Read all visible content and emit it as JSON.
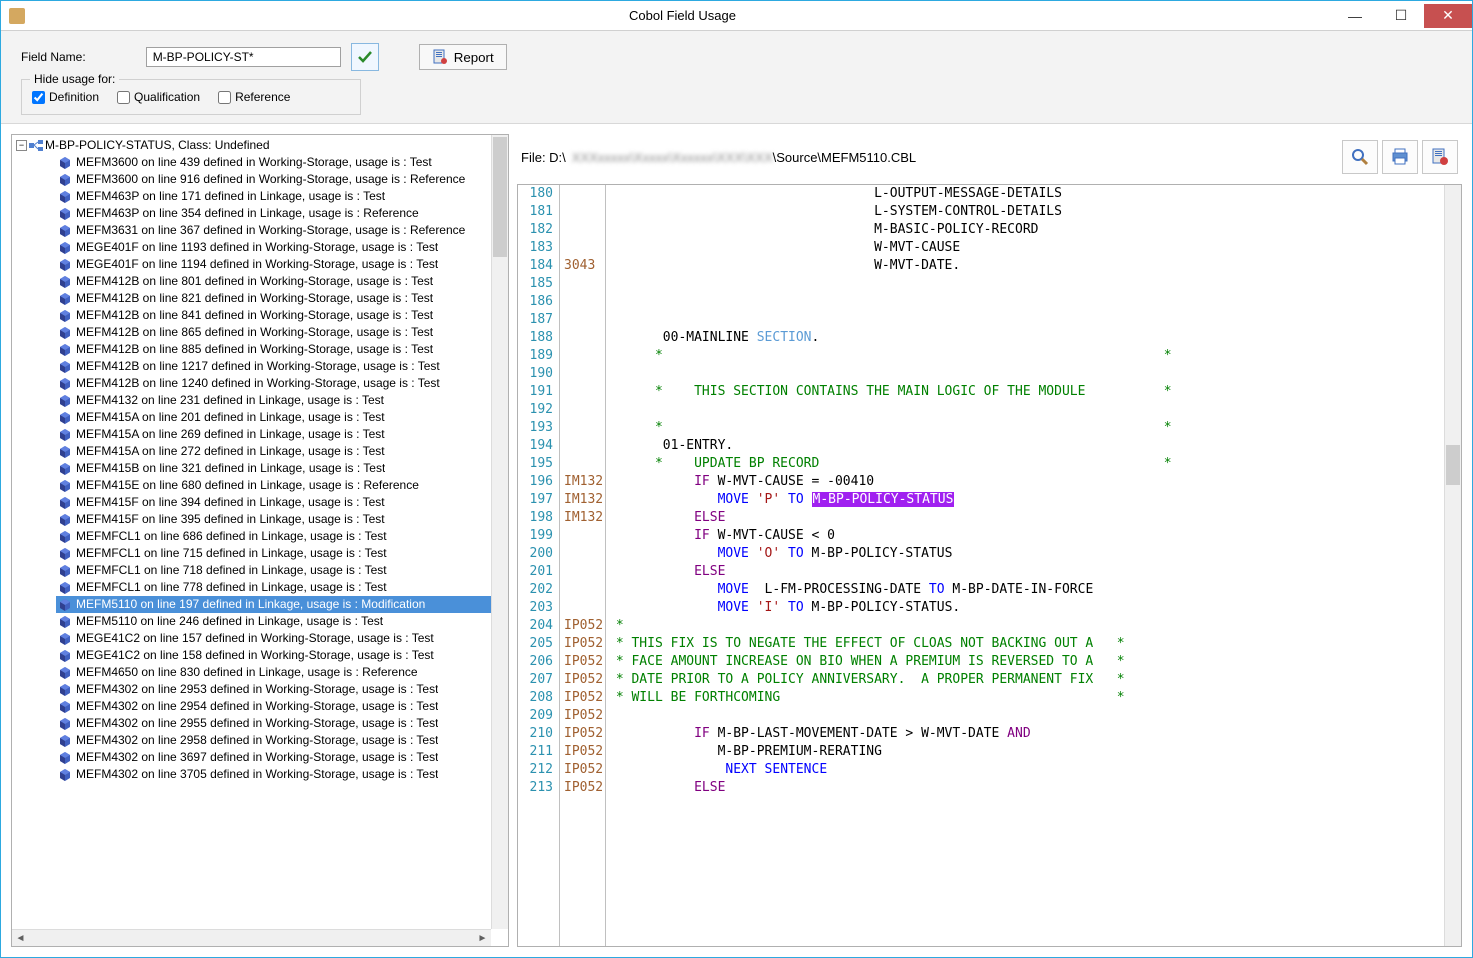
{
  "window": {
    "title": "Cobol Field Usage"
  },
  "toolbar": {
    "fieldNameLabel": "Field Name:",
    "fieldNameValue": "M-BP-POLICY-ST*",
    "reportLabel": "Report",
    "hideLegend": "Hide usage for:",
    "checks": {
      "definition": "Definition",
      "qualification": "Qualification",
      "reference": "Reference"
    }
  },
  "tree": {
    "rootLabel": "M-BP-POLICY-STATUS, Class: Undefined",
    "items": [
      {
        "l": "MEFM3600 on line 439 defined in Working-Storage, usage is : Test",
        "sel": false
      },
      {
        "l": "MEFM3600 on line 916 defined in Working-Storage, usage is : Reference",
        "sel": false
      },
      {
        "l": "MEFM463P on line 171 defined in Linkage, usage is : Test",
        "sel": false
      },
      {
        "l": "MEFM463P on line 354 defined in Linkage, usage is : Reference",
        "sel": false
      },
      {
        "l": "MEFM3631 on line 367 defined in Working-Storage, usage is : Reference",
        "sel": false
      },
      {
        "l": "MEGE401F on line 1193 defined in Working-Storage, usage is : Test",
        "sel": false
      },
      {
        "l": "MEGE401F on line 1194 defined in Working-Storage, usage is : Test",
        "sel": false
      },
      {
        "l": "MEFM412B on line 801 defined in Working-Storage, usage is : Test",
        "sel": false
      },
      {
        "l": "MEFM412B on line 821 defined in Working-Storage, usage is : Test",
        "sel": false
      },
      {
        "l": "MEFM412B on line 841 defined in Working-Storage, usage is : Test",
        "sel": false
      },
      {
        "l": "MEFM412B on line 865 defined in Working-Storage, usage is : Test",
        "sel": false
      },
      {
        "l": "MEFM412B on line 885 defined in Working-Storage, usage is : Test",
        "sel": false
      },
      {
        "l": "MEFM412B on line 1217 defined in Working-Storage, usage is : Test",
        "sel": false
      },
      {
        "l": "MEFM412B on line 1240 defined in Working-Storage, usage is : Test",
        "sel": false
      },
      {
        "l": "MEFM4132 on line 231 defined in Linkage, usage is : Test",
        "sel": false
      },
      {
        "l": "MEFM415A on line 201 defined in Linkage, usage is : Test",
        "sel": false
      },
      {
        "l": "MEFM415A on line 269 defined in Linkage, usage is : Test",
        "sel": false
      },
      {
        "l": "MEFM415A on line 272 defined in Linkage, usage is : Test",
        "sel": false
      },
      {
        "l": "MEFM415B on line 321 defined in Linkage, usage is : Test",
        "sel": false
      },
      {
        "l": "MEFM415E on line 680 defined in Linkage, usage is : Reference",
        "sel": false
      },
      {
        "l": "MEFM415F on line 394 defined in Linkage, usage is : Test",
        "sel": false
      },
      {
        "l": "MEFM415F on line 395 defined in Linkage, usage is : Test",
        "sel": false
      },
      {
        "l": "MEFMFCL1 on line 686 defined in Linkage, usage is : Test",
        "sel": false
      },
      {
        "l": "MEFMFCL1 on line 715 defined in Linkage, usage is : Test",
        "sel": false
      },
      {
        "l": "MEFMFCL1 on line 718 defined in Linkage, usage is : Test",
        "sel": false
      },
      {
        "l": "MEFMFCL1 on line 778 defined in Linkage, usage is : Test",
        "sel": false
      },
      {
        "l": "MEFM5110 on line 197 defined in Linkage, usage is : Modification",
        "sel": true
      },
      {
        "l": "MEFM5110 on line 246 defined in Linkage, usage is : Test",
        "sel": false
      },
      {
        "l": "MEGE41C2 on line 157 defined in Working-Storage, usage is : Test",
        "sel": false
      },
      {
        "l": "MEGE41C2 on line 158 defined in Working-Storage, usage is : Test",
        "sel": false
      },
      {
        "l": "MEFM4650 on line 830 defined in Linkage, usage is : Reference",
        "sel": false
      },
      {
        "l": "MEFM4302 on line 2953 defined in Working-Storage, usage is : Test",
        "sel": false
      },
      {
        "l": "MEFM4302 on line 2954 defined in Working-Storage, usage is : Test",
        "sel": false
      },
      {
        "l": "MEFM4302 on line 2955 defined in Working-Storage, usage is : Test",
        "sel": false
      },
      {
        "l": "MEFM4302 on line 2958 defined in Working-Storage, usage is : Test",
        "sel": false
      },
      {
        "l": "MEFM4302 on line 3697 defined in Working-Storage, usage is : Test",
        "sel": false
      },
      {
        "l": "MEFM4302 on line 3705 defined in Working-Storage, usage is : Test",
        "sel": false
      }
    ]
  },
  "code": {
    "fileLabel": "File: D:\\",
    "filePath": "\\Source\\MEFM5110.CBL",
    "lines": [
      {
        "n": 180,
        "seq": "",
        "html": "                                  L-OUTPUT-MESSAGE-DETAILS"
      },
      {
        "n": 181,
        "seq": "",
        "html": "                                  L-SYSTEM-CONTROL-DETAILS"
      },
      {
        "n": 182,
        "seq": "",
        "html": "                                  M-BASIC-POLICY-RECORD"
      },
      {
        "n": 183,
        "seq": "",
        "html": "                                  W-MVT-CAUSE"
      },
      {
        "n": 184,
        "seq": "3043",
        "html": "                                  W-MVT-DATE."
      },
      {
        "n": 185,
        "seq": "",
        "html": ""
      },
      {
        "n": 186,
        "seq": "",
        "html": ""
      },
      {
        "n": 187,
        "seq": "",
        "html": ""
      },
      {
        "n": 188,
        "seq": "",
        "html": "       00-MAINLINE <span class='c-lightblue'>SECTION</span>."
      },
      {
        "n": 189,
        "seq": "",
        "html": "<span class='c-green'>      *                                                                *</span>"
      },
      {
        "n": 190,
        "seq": "",
        "html": ""
      },
      {
        "n": 191,
        "seq": "",
        "html": "<span class='c-green'>      *    THIS SECTION CONTAINS THE MAIN LOGIC OF THE MODULE          *</span>"
      },
      {
        "n": 192,
        "seq": "",
        "html": ""
      },
      {
        "n": 193,
        "seq": "",
        "html": "<span class='c-green'>      *                                                                *</span>"
      },
      {
        "n": 194,
        "seq": "",
        "html": "       01-ENTRY."
      },
      {
        "n": 195,
        "seq": "",
        "html": "<span class='c-green'>      *    UPDATE BP RECORD                                            *</span>"
      },
      {
        "n": 196,
        "seq": "IM132",
        "html": "           <span class='c-purple'>IF</span> W-MVT-CAUSE = -00410"
      },
      {
        "n": 197,
        "seq": "IM132",
        "html": "              <span class='c-blue'>MOVE</span> <span class='c-red'>'P'</span> <span class='c-blue'>TO</span> <span class='hl'>M-BP-POLICY-STATUS</span>"
      },
      {
        "n": 198,
        "seq": "IM132",
        "html": "           <span class='c-purple'>ELSE</span>"
      },
      {
        "n": 199,
        "seq": "",
        "html": "           <span class='c-purple'>IF</span> W-MVT-CAUSE &lt; 0"
      },
      {
        "n": 200,
        "seq": "",
        "html": "              <span class='c-blue'>MOVE</span> <span class='c-red'>'O'</span> <span class='c-blue'>TO</span> M-BP-POLICY-STATUS"
      },
      {
        "n": 201,
        "seq": "",
        "html": "           <span class='c-purple'>ELSE</span>"
      },
      {
        "n": 202,
        "seq": "",
        "html": "              <span class='c-blue'>MOVE</span>  L-FM-PROCESSING-DATE <span class='c-blue'>TO</span> M-BP-DATE-IN-FORCE"
      },
      {
        "n": 203,
        "seq": "",
        "html": "              <span class='c-blue'>MOVE</span> <span class='c-red'>'I'</span> <span class='c-blue'>TO</span> M-BP-POLICY-STATUS."
      },
      {
        "n": 204,
        "seq": "IP052",
        "html": "<span class='c-green'> *</span>"
      },
      {
        "n": 205,
        "seq": "IP052",
        "html": "<span class='c-green'> * THIS FIX IS TO NEGATE THE EFFECT OF CLOAS NOT BACKING OUT A   *</span>"
      },
      {
        "n": 206,
        "seq": "IP052",
        "html": "<span class='c-green'> * FACE AMOUNT INCREASE ON BIO WHEN A PREMIUM IS REVERSED TO A   *</span>"
      },
      {
        "n": 207,
        "seq": "IP052",
        "html": "<span class='c-green'> * DATE PRIOR TO A POLICY ANNIVERSARY.  A PROPER PERMANENT FIX   *</span>"
      },
      {
        "n": 208,
        "seq": "IP052",
        "html": "<span class='c-green'> * WILL BE FORTHCOMING                                           *</span>"
      },
      {
        "n": 209,
        "seq": "IP052",
        "html": ""
      },
      {
        "n": 210,
        "seq": "IP052",
        "html": "           <span class='c-purple'>IF</span> M-BP-LAST-MOVEMENT-DATE &gt; W-MVT-DATE <span class='c-purple'>AND</span>"
      },
      {
        "n": 211,
        "seq": "IP052",
        "html": "              M-BP-PREMIUM-RERATING"
      },
      {
        "n": 212,
        "seq": "IP052",
        "html": "               <span class='c-blue'>NEXT SENTENCE</span>"
      },
      {
        "n": 213,
        "seq": "IP052",
        "html": "           <span class='c-purple'>ELSE</span>"
      }
    ]
  }
}
